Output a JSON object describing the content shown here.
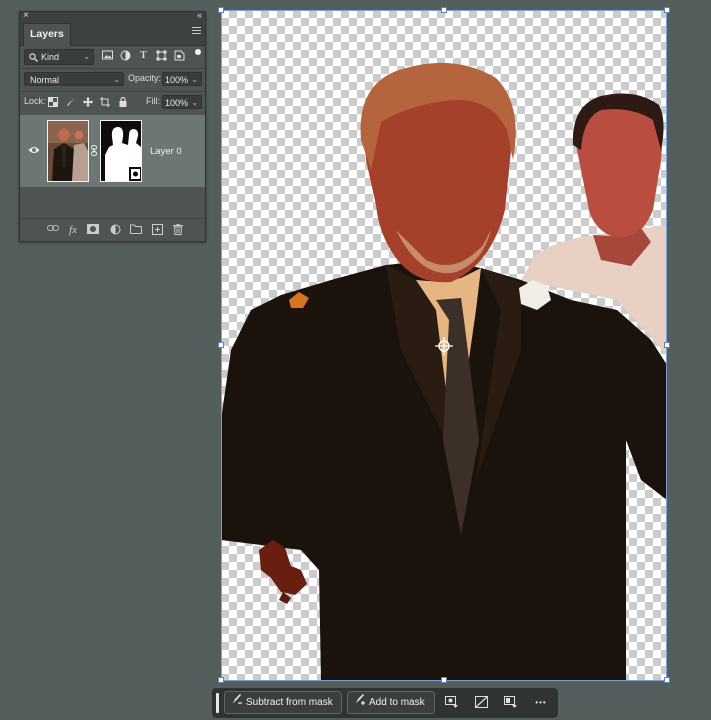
{
  "layers_panel": {
    "close_glyph": "×",
    "collapse_glyph": "‹‹",
    "tab_label": "Layers",
    "filter": {
      "kind_label": "Kind",
      "icons": [
        "image-filter-icon",
        "adjustment-filter-icon",
        "type-filter-icon",
        "shape-filter-icon",
        "smart-object-filter-icon"
      ]
    },
    "blend_mode": "Normal",
    "opacity_label": "Opacity:",
    "opacity_value": "100%",
    "lock_label": "Lock:",
    "fill_label": "Fill:",
    "fill_value": "100%",
    "layers": [
      {
        "name": "Layer 0",
        "visible": true,
        "has_mask": true
      }
    ],
    "footer_icons": [
      "link-layers-icon",
      "fx-icon",
      "add-mask-icon",
      "adjustment-layer-icon",
      "group-folder-icon",
      "new-layer-icon",
      "trash-icon"
    ],
    "fx_text": "fx"
  },
  "taskbar": {
    "subtract_label": "Subtract from mask",
    "add_label": "Add to mask",
    "more_glyph": "•••"
  },
  "colors": {
    "workspace_bg": "#545e5c",
    "panel_bg": "#4e5453",
    "selection_border": "#7aa3d8",
    "selected_row": "#6b7675"
  }
}
